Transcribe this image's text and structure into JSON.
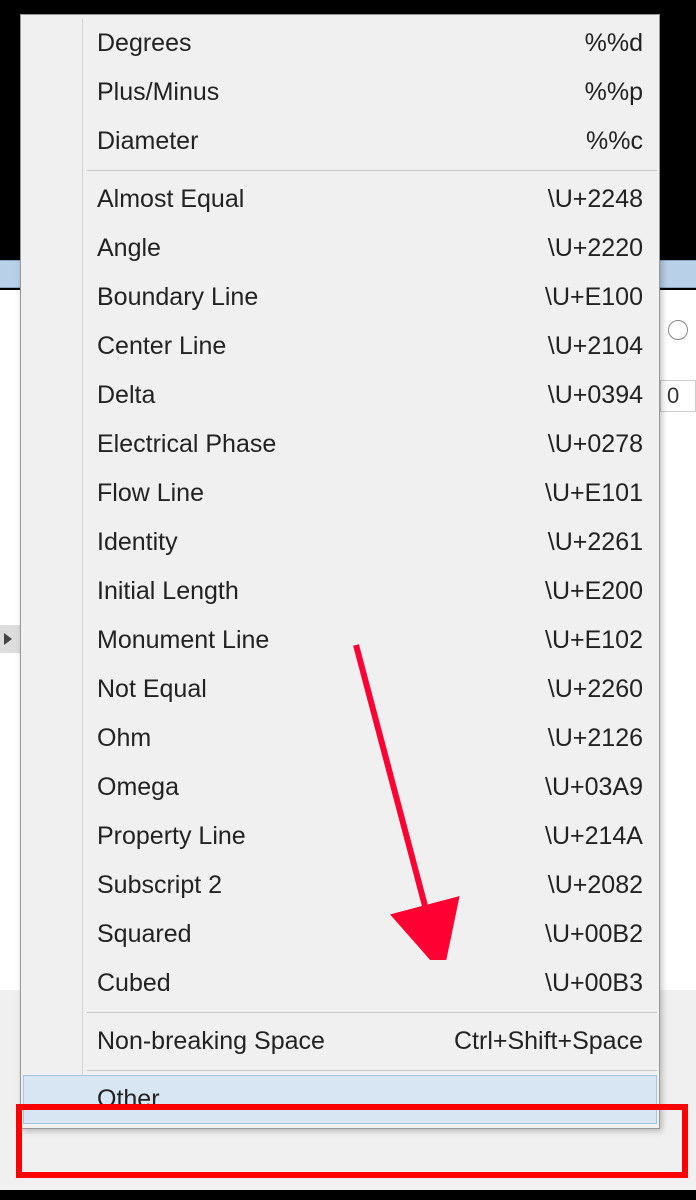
{
  "menu": {
    "group1": [
      {
        "label": "Degrees",
        "shortcut": "%%d",
        "name": "menu-item-degrees"
      },
      {
        "label": "Plus/Minus",
        "shortcut": "%%p",
        "name": "menu-item-plus-minus"
      },
      {
        "label": "Diameter",
        "shortcut": "%%c",
        "name": "menu-item-diameter"
      }
    ],
    "group2": [
      {
        "label": "Almost Equal",
        "shortcut": "\\U+2248",
        "name": "menu-item-almost-equal"
      },
      {
        "label": "Angle",
        "shortcut": "\\U+2220",
        "name": "menu-item-angle"
      },
      {
        "label": "Boundary Line",
        "shortcut": "\\U+E100",
        "name": "menu-item-boundary-line"
      },
      {
        "label": "Center Line",
        "shortcut": "\\U+2104",
        "name": "menu-item-center-line"
      },
      {
        "label": "Delta",
        "shortcut": "\\U+0394",
        "name": "menu-item-delta"
      },
      {
        "label": "Electrical Phase",
        "shortcut": "\\U+0278",
        "name": "menu-item-electrical-phase"
      },
      {
        "label": "Flow Line",
        "shortcut": "\\U+E101",
        "name": "menu-item-flow-line"
      },
      {
        "label": "Identity",
        "shortcut": "\\U+2261",
        "name": "menu-item-identity"
      },
      {
        "label": "Initial Length",
        "shortcut": "\\U+E200",
        "name": "menu-item-initial-length"
      },
      {
        "label": "Monument Line",
        "shortcut": "\\U+E102",
        "name": "menu-item-monument-line"
      },
      {
        "label": "Not Equal",
        "shortcut": "\\U+2260",
        "name": "menu-item-not-equal"
      },
      {
        "label": "Ohm",
        "shortcut": "\\U+2126",
        "name": "menu-item-ohm"
      },
      {
        "label": "Omega",
        "shortcut": "\\U+03A9",
        "name": "menu-item-omega"
      },
      {
        "label": "Property Line",
        "shortcut": "\\U+214A",
        "name": "menu-item-property-line"
      },
      {
        "label": "Subscript 2",
        "shortcut": "\\U+2082",
        "name": "menu-item-subscript-2"
      },
      {
        "label": "Squared",
        "shortcut": "\\U+00B2",
        "name": "menu-item-squared"
      },
      {
        "label": "Cubed",
        "shortcut": "\\U+00B3",
        "name": "menu-item-cubed"
      }
    ],
    "group3": [
      {
        "label": "Non-breaking Space",
        "shortcut": "Ctrl+Shift+Space",
        "name": "menu-item-nonbreaking-space"
      }
    ],
    "group4": [
      {
        "label": "Other...",
        "shortcut": "",
        "name": "menu-item-other",
        "highlight": true
      }
    ]
  },
  "background": {
    "field_value": "0"
  },
  "annotation": {
    "arrow_color": "#ff0033",
    "box_color": "#ff0000"
  }
}
